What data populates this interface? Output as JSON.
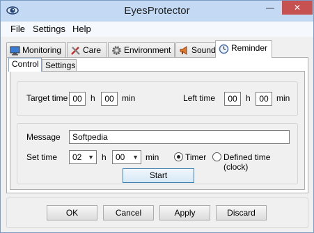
{
  "window": {
    "title": "EyesProtector",
    "minimize_glyph": "—",
    "close_glyph": "✕"
  },
  "menu": {
    "items": [
      "File",
      "Settings",
      "Help"
    ]
  },
  "tabs": [
    {
      "label": "Monitoring",
      "icon": "monitor-icon"
    },
    {
      "label": "Care",
      "icon": "tools-icon"
    },
    {
      "label": "Environment",
      "icon": "gear-icon"
    },
    {
      "label": "Sound",
      "icon": "megaphone-icon"
    },
    {
      "label": "Reminder",
      "icon": "clock-icon"
    }
  ],
  "active_tab": "Reminder",
  "subtabs": [
    "Control",
    "Settings"
  ],
  "active_subtab": "Control",
  "target": {
    "label": "Target time",
    "hours": "00",
    "h_unit": "h",
    "minutes": "00",
    "min_unit": "min"
  },
  "left": {
    "label": "Left time",
    "hours": "00",
    "h_unit": "h",
    "minutes": "00",
    "min_unit": "min"
  },
  "message": {
    "label": "Message",
    "value": "Softpedia"
  },
  "set_time": {
    "label": "Set time",
    "hours": "02",
    "h_unit": "h",
    "minutes": "00",
    "min_unit": "min",
    "timer_label": "Timer",
    "defined_label": "Defined time (clock)",
    "selected": "Timer"
  },
  "start_label": "Start",
  "footer": {
    "ok": "OK",
    "cancel": "Cancel",
    "apply": "Apply",
    "discard": "Discard"
  },
  "colors": {
    "titlebar": "#c4daf4",
    "close": "#c75050",
    "focus_border": "#3c7fb1"
  }
}
